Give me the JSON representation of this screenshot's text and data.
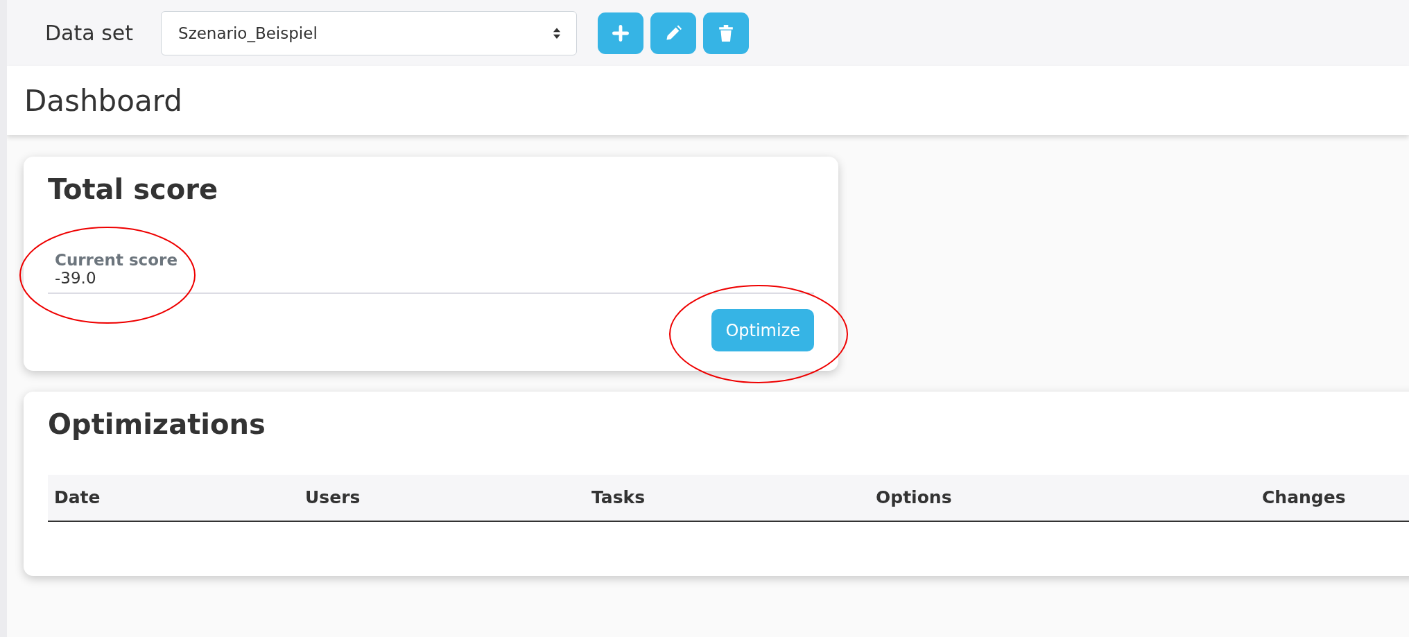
{
  "toolbar": {
    "label": "Data set",
    "dataset_select": {
      "value": "Szenario_Beispiel"
    },
    "buttons": [
      {
        "kind": "add"
      },
      {
        "kind": "edit"
      },
      {
        "kind": "delete"
      }
    ]
  },
  "page_title": "Dashboard",
  "score_card": {
    "title": "Total score",
    "field": {
      "label": "Current score",
      "value": "-39.0"
    },
    "button": "Optimize"
  },
  "optimizations_card": {
    "title": "Optimizations",
    "table": {
      "columns": [
        "Date",
        "Users",
        "Tasks",
        "Options",
        "Changes"
      ]
    }
  }
}
